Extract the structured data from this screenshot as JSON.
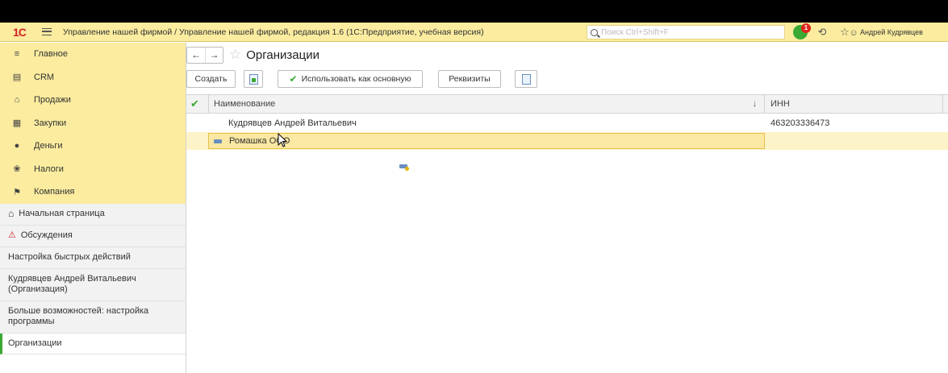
{
  "app": {
    "logo": "1С",
    "title": "Управление нашей фирмой / Управление нашей фирмой, редакция 1.6  (1С:Предприятие, учебная версия)",
    "search_placeholder": "Поиск Ctrl+Shift+F",
    "notifications_count": "1",
    "user_name": "Андрей Кудрявцев"
  },
  "sidebar": {
    "sections": [
      {
        "label": "Главное",
        "icon": "menu-icon"
      },
      {
        "label": "CRM",
        "icon": "crm-icon"
      },
      {
        "label": "Продажи",
        "icon": "shop-icon"
      },
      {
        "label": "Закупки",
        "icon": "purchases-icon"
      },
      {
        "label": "Деньги",
        "icon": "ruble-icon"
      },
      {
        "label": "Налоги",
        "icon": "emblem-icon"
      },
      {
        "label": "Компания",
        "icon": "flag-icon"
      }
    ],
    "history": [
      {
        "label": "Начальная страница",
        "icon": "home-icon"
      },
      {
        "label": "Обсуждения",
        "icon": "discussions-icon"
      },
      {
        "label": "Настройка быстрых действий"
      },
      {
        "label": "Кудрявцев Андрей Витальевич (Организация)"
      },
      {
        "label": "Больше возможностей: настройка программы"
      },
      {
        "label": "Организации"
      }
    ]
  },
  "page": {
    "title": "Организации",
    "toolbar": {
      "create": "Создать",
      "use_as_main": "Использовать как основную",
      "requisites": "Реквизиты"
    },
    "table": {
      "columns": [
        "Наименование",
        "ИНН"
      ],
      "rows": [
        {
          "name": "Кудрявцев Андрей Витальевич",
          "inn": "463203336473",
          "main": true
        },
        {
          "name": "Ромашка ООО",
          "inn": "",
          "main": false
        }
      ]
    }
  }
}
